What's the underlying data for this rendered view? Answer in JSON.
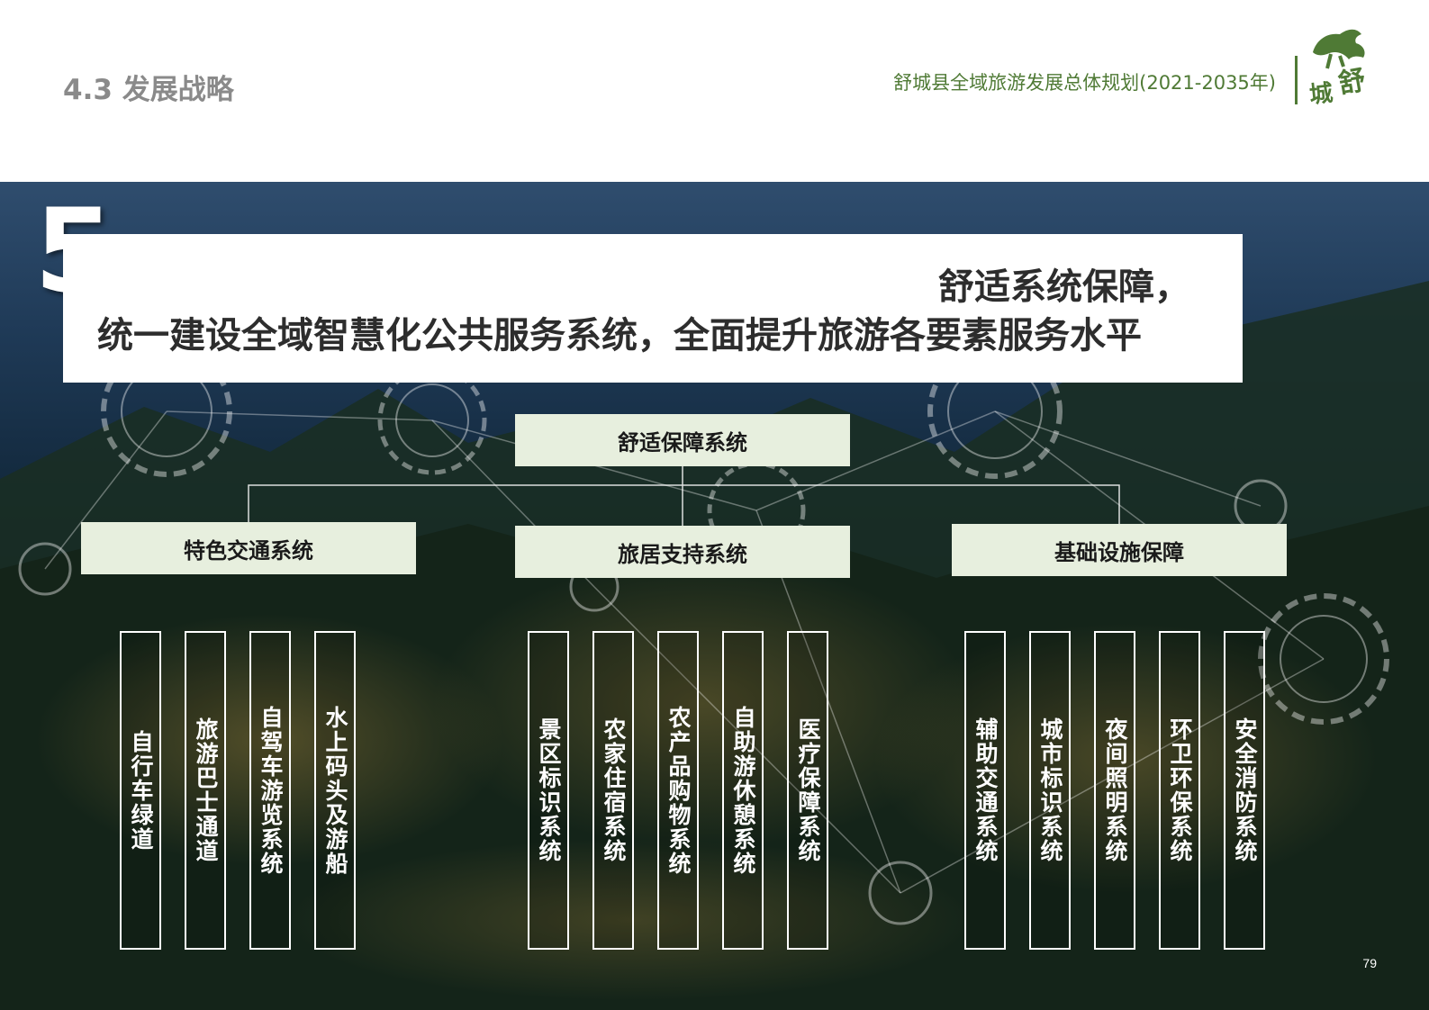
{
  "header": {
    "section_title": "4.3 发展战略",
    "doc_title": "舒城县全域旅游发展总体规划(2021-2035年)",
    "logo_chars": [
      "舒",
      "城"
    ]
  },
  "hero": {
    "number": "5",
    "banner_line1": "舒适系统保障，",
    "banner_line2": "统一建设全域智慧化公共服务系统，全面提升旅游各要素服务水平"
  },
  "chart_data": {
    "type": "tree",
    "root": "舒适保障系统",
    "branches": [
      {
        "label": "特色交通系统",
        "items": [
          "自行车绿道",
          "旅游巴士通道",
          "自驾车游览系统",
          "水上码头及游船"
        ]
      },
      {
        "label": "旅居支持系统",
        "items": [
          "景区标识系统",
          "农家住宿系统",
          "农产品购物系统",
          "自助游休憩系统",
          "医疗保障系统"
        ]
      },
      {
        "label": "基础设施保障",
        "items": [
          "辅助交通系统",
          "城市标识系统",
          "夜间照明系统",
          "环卫环保系统",
          "安全消防系统"
        ]
      }
    ]
  },
  "footer": {
    "page_number": "79"
  },
  "colors": {
    "accent_green": "#4f7a35",
    "node_fill": "#e7efde",
    "banner_fill": "#ffffff"
  }
}
